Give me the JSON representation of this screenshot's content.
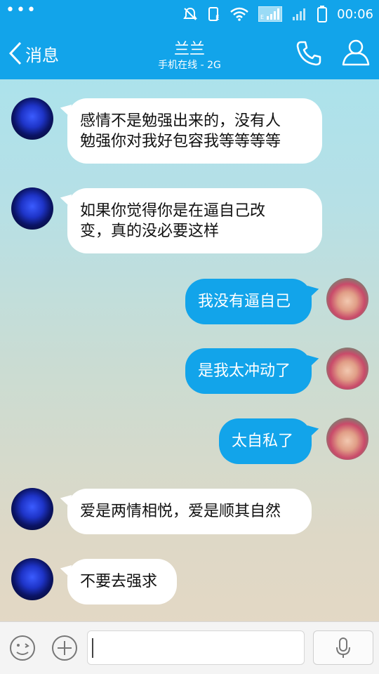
{
  "status_bar": {
    "time": "00:06",
    "network_label": "E",
    "icons": [
      "more-dots-icon",
      "mute-icon",
      "sim-icon",
      "wifi-icon",
      "signal-icon",
      "signal-weak-icon",
      "battery-icon"
    ]
  },
  "header": {
    "back_label": "消息",
    "title": "兰兰",
    "subtitle": "手机在线 - 2G",
    "icons": [
      "back-chevron-icon",
      "phone-icon",
      "contact-icon"
    ]
  },
  "messages": [
    {
      "side": "in",
      "text": "感情不是勉强出来的，没有人\n勉强你对我好包容我等等等等"
    },
    {
      "side": "in",
      "text": "如果你觉得你是在逼自己改\n变，真的没必要这样"
    },
    {
      "side": "out",
      "text": "我没有逼自己"
    },
    {
      "side": "out",
      "text": "是我太冲动了"
    },
    {
      "side": "out",
      "text": "太自私了"
    },
    {
      "side": "in",
      "text": "爱是两情相悦，爱是顺其自然"
    },
    {
      "side": "in",
      "text": "不要去强求"
    }
  ],
  "input_bar": {
    "value": "",
    "icons": [
      "emoji-icon",
      "plus-icon",
      "microphone-icon"
    ]
  },
  "colors": {
    "accent": "#12a4ea",
    "incoming_bubble": "#ffffff",
    "outgoing_bubble": "#12a4ea"
  }
}
